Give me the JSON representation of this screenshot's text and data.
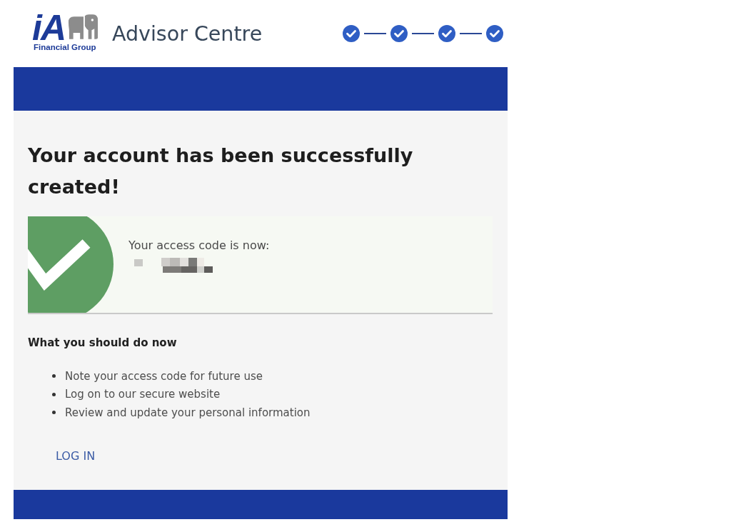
{
  "header": {
    "logo": {
      "mark": "iA",
      "tagline": "Financial Group"
    },
    "title": "Advisor Centre",
    "steps": [
      {
        "completed": true
      },
      {
        "completed": true
      },
      {
        "completed": true
      },
      {
        "completed": true
      }
    ]
  },
  "confirmation": {
    "heading": "Your account has been successfully created!",
    "access_code_label": "Your access code is now:",
    "next_steps_heading": "What you should do now",
    "next_steps": [
      "Note your access code for future use",
      "Log on to our secure website",
      "Review and update your personal information"
    ],
    "login_link": "LOG IN"
  }
}
